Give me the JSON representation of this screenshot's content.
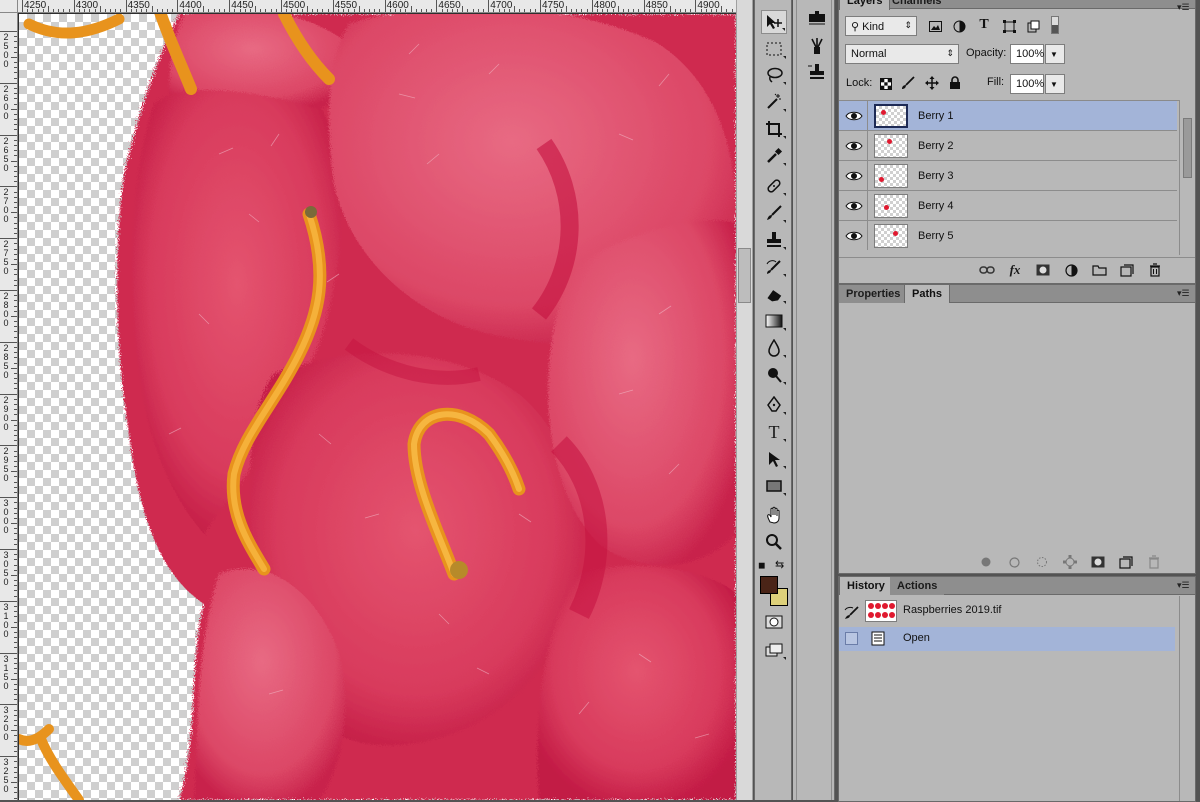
{
  "ruler": {
    "top_labels": [
      "4250",
      "4300",
      "4350",
      "4400",
      "4450",
      "4500",
      "4550",
      "4600",
      "4650",
      "4700",
      "4750",
      "4800",
      "4850",
      "4900"
    ],
    "left_labels": [
      "2500",
      "2600",
      "2650",
      "2700",
      "2750",
      "2800",
      "2850",
      "2900",
      "2950",
      "3000",
      "3050",
      "3100",
      "3150",
      "3200",
      "3250"
    ]
  },
  "tools": {
    "items": [
      "move-tool",
      "marquee-tool",
      "lasso-tool",
      "quick-selection-tool",
      "crop-tool",
      "eyedropper-tool",
      "healing-brush-tool",
      "brush-tool",
      "clone-stamp-tool",
      "history-brush-tool",
      "eraser-tool",
      "gradient-tool",
      "blur-tool",
      "dodge-tool",
      "pen-tool",
      "type-tool",
      "path-selection-tool",
      "rectangle-tool",
      "hand-tool",
      "zoom-tool"
    ],
    "type_glyph": "T",
    "colors": {
      "foreground": "#4a2417",
      "background": "#ddd07a"
    }
  },
  "layers_panel": {
    "tabs": [
      "Layers",
      "Channels"
    ],
    "filter_label": "Kind",
    "blend_mode": "Normal",
    "opacity_label": "Opacity:",
    "opacity_value": "100%",
    "lock_label": "Lock:",
    "fill_label": "Fill:",
    "fill_value": "100%",
    "layers": [
      {
        "name": "Berry 1",
        "selected": true
      },
      {
        "name": "Berry 2",
        "selected": false
      },
      {
        "name": "Berry 3",
        "selected": false
      },
      {
        "name": "Berry 4",
        "selected": false
      },
      {
        "name": "Berry 5",
        "selected": false
      }
    ],
    "fx_label": "fx"
  },
  "paths_panel": {
    "tabs": [
      "Properties",
      "Paths"
    ]
  },
  "history_panel": {
    "tabs": [
      "History",
      "Actions"
    ],
    "snapshot_name": "Raspberries 2019.tif",
    "states": [
      "Open"
    ]
  }
}
